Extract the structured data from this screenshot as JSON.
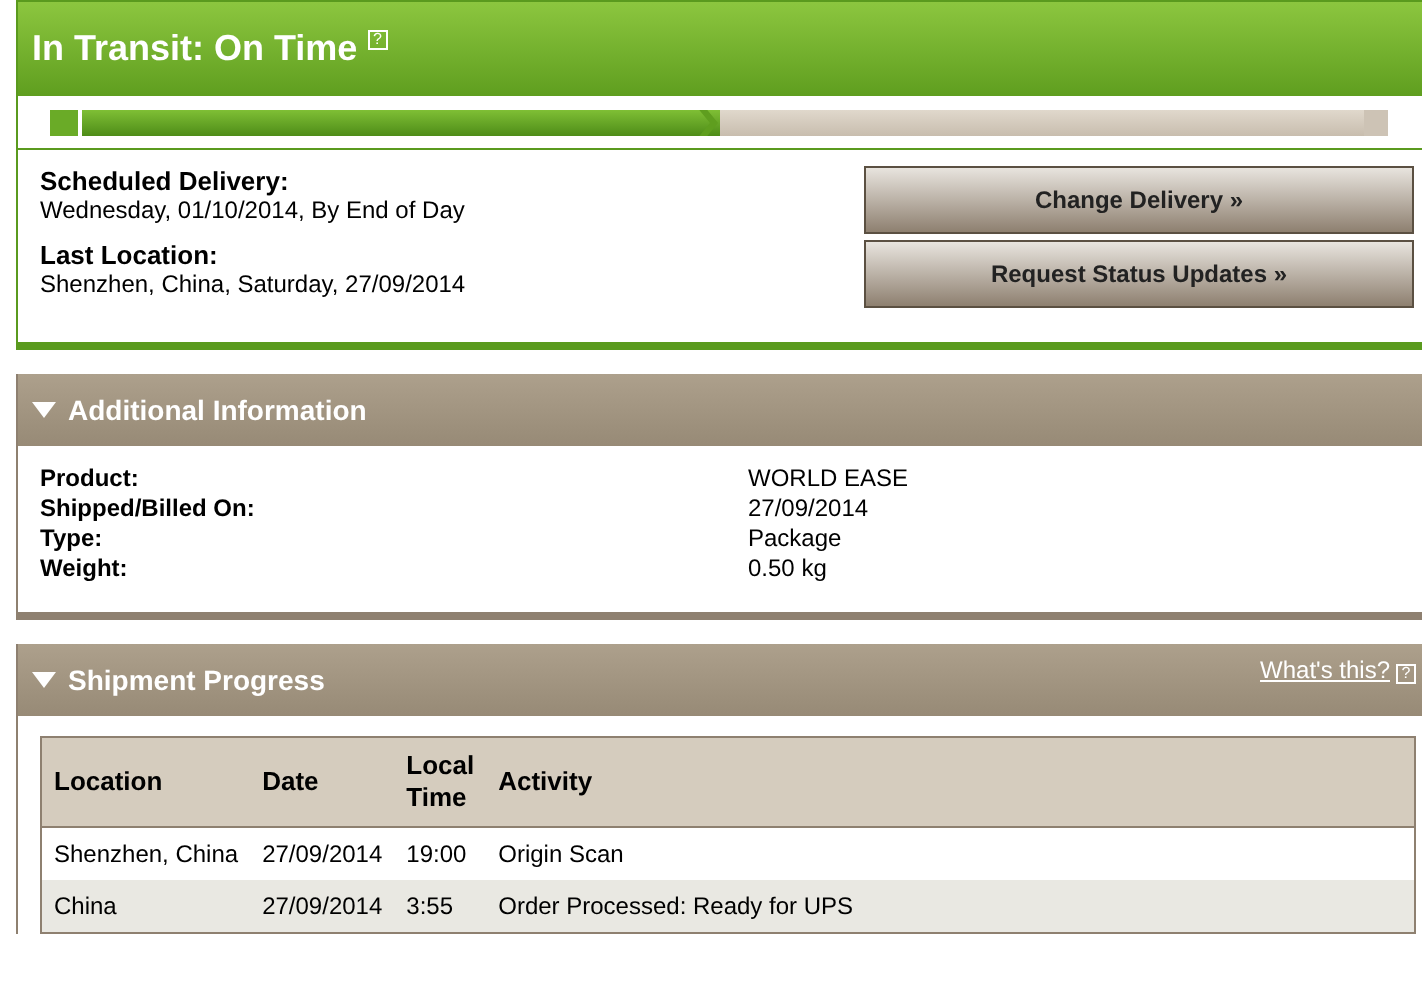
{
  "status": {
    "title": "In Transit: On Time",
    "help": "?",
    "level": 0.5
  },
  "delivery": [
    {
      "label": "Scheduled Delivery:",
      "value": "Wednesday, 01/10/2014, By End of Day"
    },
    {
      "label": "Last Location:",
      "value": "Shenzhen, China, Saturday, 27/09/2014"
    }
  ],
  "buttons": [
    "Change Delivery »",
    "Request Status Updates »"
  ],
  "additional_information": {
    "title": "Additional Information",
    "expanded": true,
    "rows": [
      {
        "label": "Product:",
        "value": "WORLD EASE"
      },
      {
        "label": "Shipped/Billed On:",
        "value": "27/09/2014"
      },
      {
        "label": "Type:",
        "value": "Package"
      },
      {
        "label": "Weight:",
        "value": "0.50 kg"
      }
    ]
  },
  "shipment_progress": {
    "title": "Shipment Progress",
    "expanded": true,
    "link": "What's this?",
    "help": "?",
    "columns": [
      "Location",
      "Date",
      "Local Time",
      "Activity"
    ],
    "rows": [
      [
        "Shenzhen, China",
        "27/09/2014",
        "19:00",
        "Origin Scan"
      ],
      [
        "China",
        "27/09/2014",
        "3:55",
        "Order Processed: Ready for UPS"
      ]
    ]
  }
}
